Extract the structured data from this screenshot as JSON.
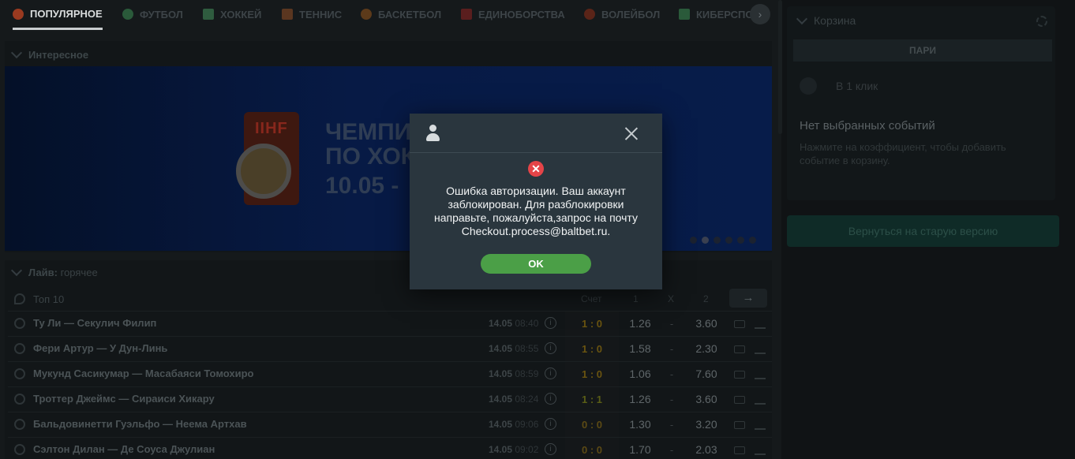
{
  "tabs": [
    {
      "label": "ПОПУЛЯРНОЕ",
      "icon": "fire-icon",
      "color": "#9a3a20",
      "active": true
    },
    {
      "label": "ФУТБОЛ",
      "icon": "football-icon",
      "color": "#2a5a3a"
    },
    {
      "label": "ХОККЕЙ",
      "icon": "hockey-stick-icon",
      "color": "#2f5c3f"
    },
    {
      "label": "ТЕННИС",
      "icon": "tennis-racket-icon",
      "color": "#5a3620"
    },
    {
      "label": "БАСКЕТБОЛ",
      "icon": "basketball-icon",
      "color": "#5c3a1a"
    },
    {
      "label": "ЕДИНОБОРСТВА",
      "icon": "glove-icon",
      "color": "#5a1e1e"
    },
    {
      "label": "ВОЛЕЙБОЛ",
      "icon": "volleyball-icon",
      "color": "#5a2418"
    },
    {
      "label": "КИБЕРСПО",
      "icon": "esports-icon",
      "color": "#2a5a3a"
    }
  ],
  "interesting": {
    "title": "Интересное",
    "banner": {
      "logo_text": "IIHF",
      "title_line1": "ЧЕМПИ",
      "title_line2": "ПО ХОК",
      "date": "10.05 -"
    }
  },
  "live": {
    "label": "Лайв:",
    "sub": "горячее",
    "top_label": "Топ 10",
    "columns": {
      "score": "Счет",
      "one": "1",
      "x": "X",
      "two": "2"
    },
    "rows": [
      {
        "name": "Ту Ли — Секулич Филип",
        "date": "14.05",
        "time": "08:40",
        "score": "1 : 0",
        "o1": "1.26",
        "ox": "-",
        "o2": "3.60",
        "kind": "lead"
      },
      {
        "name": "Фери Артур — У Дун-Линь",
        "date": "14.05",
        "time": "08:55",
        "score": "1 : 0",
        "o1": "1.58",
        "ox": "-",
        "o2": "2.30",
        "kind": "lead"
      },
      {
        "name": "Мукунд Сасикумар — Масабаяси Томохиро",
        "date": "14.05",
        "time": "08:59",
        "score": "1 : 0",
        "o1": "1.06",
        "ox": "-",
        "o2": "7.60",
        "kind": "lead"
      },
      {
        "name": "Троттер Джеймс — Сираиси Хикару",
        "date": "14.05",
        "time": "08:24",
        "score": "1 : 1",
        "o1": "1.26",
        "ox": "-",
        "o2": "3.60",
        "kind": "draw"
      },
      {
        "name": "Бальдовинетти Гуэльфо — Неема Артхав",
        "date": "14.05",
        "time": "09:06",
        "score": "0 : 0",
        "o1": "1.30",
        "ox": "-",
        "o2": "3.20",
        "kind": "zero"
      },
      {
        "name": "Сэлтон Дилан — Де Соуса Джулиан",
        "date": "14.05",
        "time": "09:02",
        "score": "0 : 0",
        "o1": "1.70",
        "ox": "-",
        "o2": "2.03",
        "kind": "zero"
      }
    ]
  },
  "cart": {
    "title": "Корзина",
    "tab_label": "ПАРИ",
    "one_click_label": "В 1 клик",
    "empty_title": "Нет выбранных событий",
    "empty_text": "Нажмите на коэффициент, чтобы добавить событие в корзину."
  },
  "old_version_label": "Вернуться на старую версию",
  "modal": {
    "message": "Ошибка авторизации. Ваш аккаунт заблокирован. Для разблокировки направьте, пожалуйста,запрос на почту Checkout.process@baltbet.ru.",
    "ok_label": "OK",
    "error_glyph": "✕"
  },
  "colors": {
    "ok_button": "#4b9f47",
    "error_icon": "#e54448",
    "modal_bg": "#2a363e"
  }
}
